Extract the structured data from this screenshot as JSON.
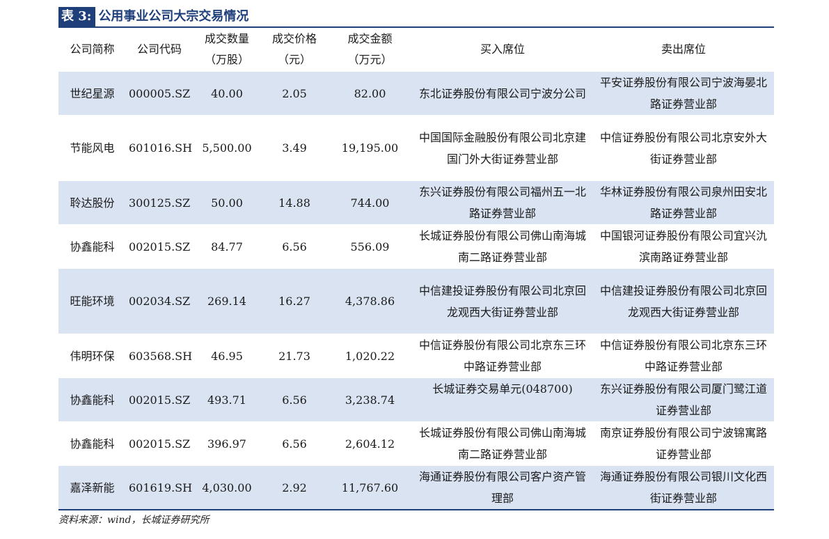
{
  "title": {
    "tag": "表 3:",
    "text": "公用事业公司大宗交易情况"
  },
  "table": {
    "headers": [
      "公司简称",
      "公司代码",
      "成交数量\n（万股）",
      "成交价格\n（元）",
      "成交金额\n（万元）",
      "买入席位",
      "卖出席位"
    ],
    "rows": [
      [
        "世纪星源",
        "000005.SZ",
        "40.00",
        "2.05",
        "82.00",
        "东北证券股份有限公司宁波分公司",
        "平安证券股份有限公司宁波海晏北路证券营业部"
      ],
      [
        "节能风电",
        "601016.SH",
        "5,500.00",
        "3.49",
        "19,195.00",
        "中国国际金融股份有限公司北京建国门外大街证券营业部",
        "中信证券股份有限公司北京安外大街证券营业部"
      ],
      [
        "聆达股份",
        "300125.SZ",
        "50.00",
        "14.88",
        "744.00",
        "东兴证券股份有限公司福州五一北路证券营业部",
        "华林证券股份有限公司泉州田安北路证券营业部"
      ],
      [
        "协鑫能科",
        "002015.SZ",
        "84.77",
        "6.56",
        "556.09",
        "长城证券股份有限公司佛山南海城南二路证券营业部",
        "中国银河证券股份有限公司宜兴氿滨南路证券营业部"
      ],
      [
        "旺能环境",
        "002034.SZ",
        "269.14",
        "16.27",
        "4,378.86",
        "中信建投证券股份有限公司北京回龙观西大街证券营业部",
        "中信建投证券股份有限公司北京回龙观西大街证券营业部"
      ],
      [
        "伟明环保",
        "603568.SH",
        "46.95",
        "21.73",
        "1,020.22",
        "中信证券股份有限公司北京东三环中路证券营业部",
        "中信证券股份有限公司北京东三环中路证券营业部"
      ],
      [
        "协鑫能科",
        "002015.SZ",
        "493.71",
        "6.56",
        "3,238.74",
        "长城证券交易单元(048700)",
        "东兴证券股份有限公司厦门鹭江道证券营业部"
      ],
      [
        "协鑫能科",
        "002015.SZ",
        "396.97",
        "6.56",
        "2,604.12",
        "长城证券股份有限公司佛山南海城南二路证券营业部",
        "南京证券股份有限公司宁波锦寓路证券营业部"
      ],
      [
        "嘉泽新能",
        "601619.SH",
        "4,030.00",
        "2.92",
        "11,767.60",
        "海通证券股份有限公司客户资产管理部",
        "海通证券股份有限公司银川文化西街证券营业部"
      ]
    ]
  },
  "source": "资料来源：wind，长城证券研究所",
  "colors": {
    "accent": "#1f3f7a",
    "row_shade": "#dae3f2"
  }
}
